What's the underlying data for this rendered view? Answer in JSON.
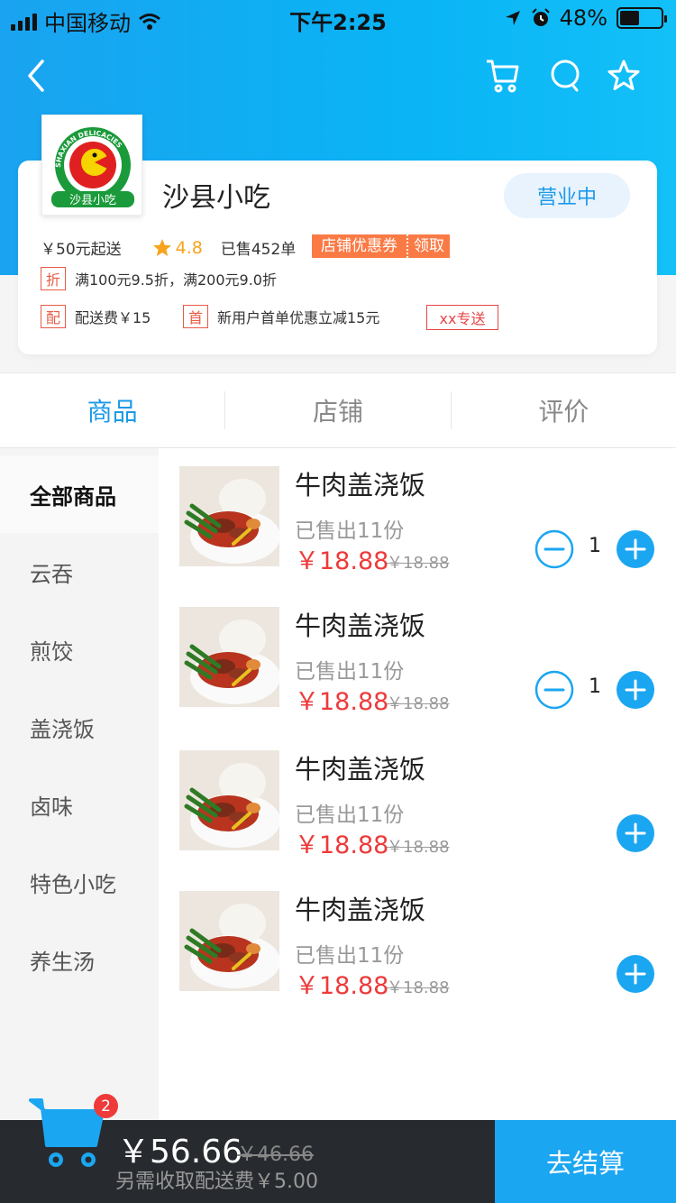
{
  "status_bar": {
    "carrier": "中国移动",
    "time": "下午2:25",
    "battery": "48%",
    "battery_level": 0.48
  },
  "nav": {
    "icons": [
      "back-icon",
      "cart-icon",
      "search-icon",
      "star-icon"
    ]
  },
  "shop": {
    "logo_text_top": "SHAXIAN DELICACIES",
    "logo_text_bottom": "沙县小吃",
    "name": "沙县小吃",
    "status": "营业中",
    "min_order": "￥50元起送",
    "rating": "4.8",
    "sold": "已售452单",
    "coupon_label": "店铺优惠券",
    "coupon_action": "领取",
    "promos": [
      {
        "tag": "折",
        "text": "满100元9.5折，满200元9.0折"
      },
      {
        "tag": "配",
        "text": "配送费￥15"
      },
      {
        "tag": "首",
        "text": "新用户首单优惠立减15元"
      }
    ],
    "special_tag": "xx专送"
  },
  "tabs": [
    {
      "label": "商品",
      "active": true
    },
    {
      "label": "店铺",
      "active": false
    },
    {
      "label": "评价",
      "active": false
    }
  ],
  "categories": [
    {
      "label": "全部商品",
      "active": true
    },
    {
      "label": "云吞"
    },
    {
      "label": "煎饺"
    },
    {
      "label": "盖浇饭"
    },
    {
      "label": "卤味"
    },
    {
      "label": "特色小吃"
    },
    {
      "label": "养生汤"
    }
  ],
  "products": [
    {
      "name": "牛肉盖浇饭",
      "sold": "已售出11份",
      "price": "￥18.88",
      "old_price": "￥18.88",
      "qty": "1",
      "in_cart": true
    },
    {
      "name": "牛肉盖浇饭",
      "sold": "已售出11份",
      "price": "￥18.88",
      "old_price": "￥18.88",
      "qty": "1",
      "in_cart": true
    },
    {
      "name": "牛肉盖浇饭",
      "sold": "已售出11份",
      "price": "￥18.88",
      "old_price": "￥18.88",
      "qty": "",
      "in_cart": false
    },
    {
      "name": "牛肉盖浇饭",
      "sold": "已售出11份",
      "price": "￥18.88",
      "old_price": "￥18.88",
      "qty": "",
      "in_cart": false
    }
  ],
  "cart": {
    "count": "2",
    "total": "￥56.66",
    "old_total": "￥46.66",
    "delivery_note": "另需收取配送费￥5.00",
    "checkout_label": "去结算"
  },
  "colors": {
    "accent": "#1aa3f0",
    "price": "#ee3a3a",
    "coupon": "#fa7a45",
    "bottom_bar": "#272a2f"
  }
}
